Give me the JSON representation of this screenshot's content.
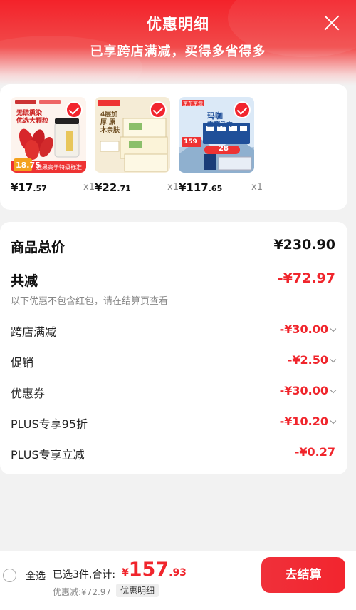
{
  "header": {
    "title": "优惠明细",
    "subtitle": "已享跨店满减，买得多省得多"
  },
  "products": [
    {
      "price_int": "¥17",
      "price_dec": ".57",
      "qty": "x1",
      "thumb_text_top": "无硫熏染 优选大颗粒",
      "thumb_text_bottom": "选果高于特级标准",
      "thumb_price": "18.75"
    },
    {
      "price_int": "¥22",
      "price_dec": ".71",
      "qty": "x1",
      "thumb_text_top": "4层加厚 原木亲肤"
    },
    {
      "price_int": "¥117",
      "price_dec": ".65",
      "qty": "x1",
      "thumb_badge": "京东京造",
      "thumb_text_top": "玛咖",
      "thumb_text_mid": "重燃活力",
      "thumb_text_promo": "28",
      "thumb_price": "159"
    }
  ],
  "summary": {
    "total_label": "商品总价",
    "total_value": "¥230.90",
    "discount_label": "共减",
    "discount_value": "-¥72.97",
    "note": "以下优惠不包含红包，请在结算页查看",
    "items": [
      {
        "label": "跨店满减",
        "value": "-¥30.00"
      },
      {
        "label": "促销",
        "value": "-¥2.50"
      },
      {
        "label": "优惠券",
        "value": "-¥30.00"
      },
      {
        "label": "PLUS专享95折",
        "value": "-¥10.20"
      },
      {
        "label": "PLUS专享立减",
        "value": "-¥0.27"
      }
    ]
  },
  "bottom_bar": {
    "select_all": "全选",
    "selected_text": "已选3件,合计:",
    "total_yen": "¥",
    "total_int": "157",
    "total_dec": ".93",
    "discount_text": "优惠减:¥72.97",
    "detail_label": "优惠明细",
    "checkout_label": "去结算"
  },
  "colors": {
    "accent": "#f2252e",
    "header_red": "#f3222a",
    "background": "#f2f2f2"
  }
}
